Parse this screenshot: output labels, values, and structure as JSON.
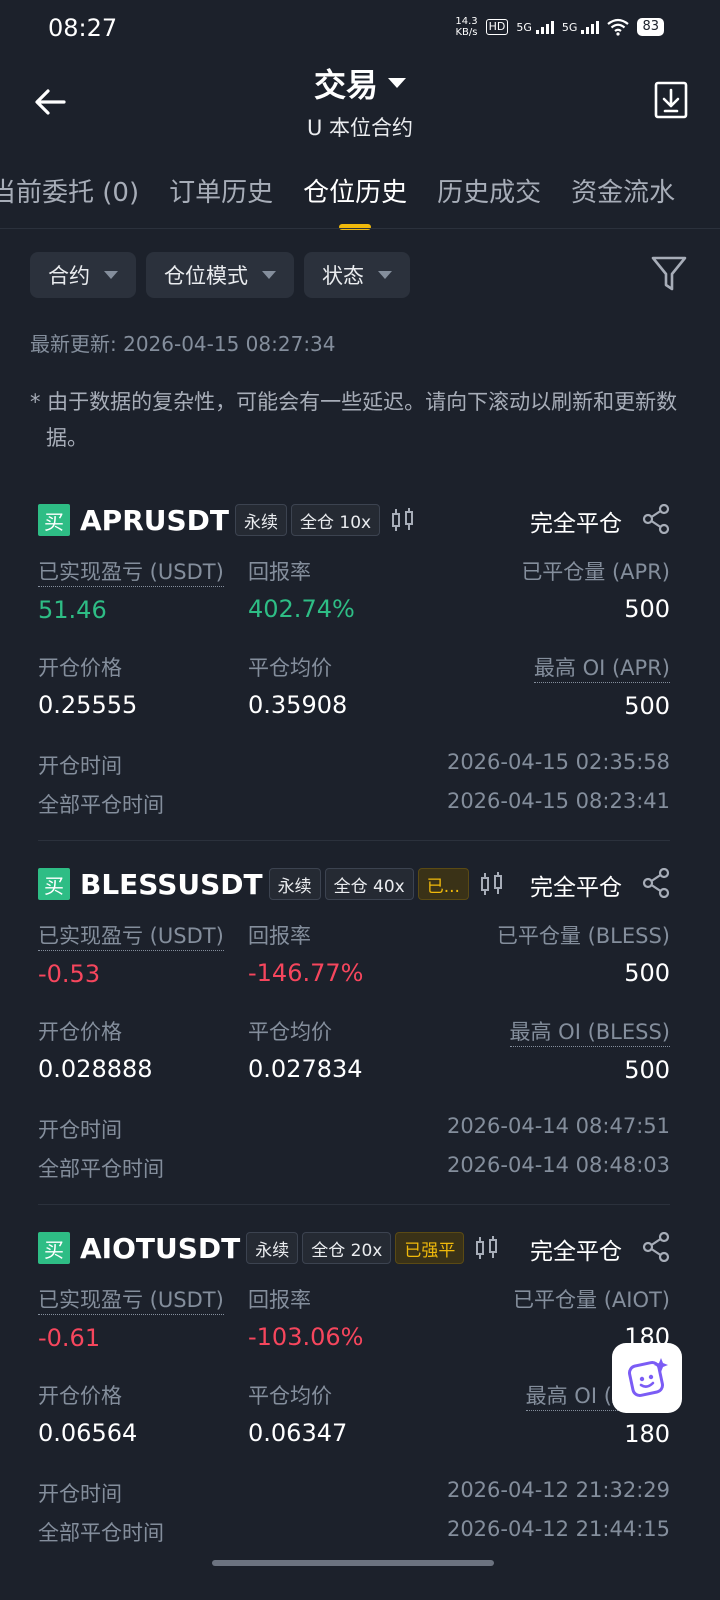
{
  "status_bar": {
    "time": "08:27",
    "net_speed_value": "14.3",
    "net_speed_unit": "KB/s",
    "hd": "HD",
    "signal1": "5G",
    "signal2": "5G",
    "battery": "83"
  },
  "header": {
    "title": "交易",
    "subtitle": "U 本位合约"
  },
  "tabs": [
    {
      "label": "当前委托 (0)"
    },
    {
      "label": "订单历史"
    },
    {
      "label": "仓位历史",
      "active": true
    },
    {
      "label": "历史成交"
    },
    {
      "label": "资金流水"
    }
  ],
  "filters": {
    "contract": "合约",
    "position_mode": "仓位模式",
    "status": "状态"
  },
  "last_updated": "最新更新: 2026-04-15 08:27:34",
  "notice": "* 由于数据的复杂性，可能会有一些延迟。请向下滚动以刷新和更新数据。",
  "labels": {
    "realized_pnl": "已实现盈亏 (USDT)",
    "roi": "回报率",
    "entry_price": "开仓价格",
    "avg_close_price": "平仓均价",
    "open_time": "开仓时间",
    "full_close_time": "全部平仓时间"
  },
  "positions": [
    {
      "side": "买",
      "symbol": "APRUSDT",
      "type_tag": "永续",
      "margin_tag": "全仓 10x",
      "status": "完全平仓",
      "realized_pnl": "51.46",
      "roi": "402.74%",
      "closed_qty_label": "已平仓量 (APR)",
      "closed_qty": "500",
      "entry_price": "0.25555",
      "avg_close_price": "0.35908",
      "max_oi_label": "最高 OI (APR)",
      "max_oi": "500",
      "open_time": "2026-04-15 02:35:58",
      "full_close_time": "2026-04-15 08:23:41"
    },
    {
      "side": "买",
      "symbol": "BLESSUSDT",
      "type_tag": "永续",
      "margin_tag": "全仓 40x",
      "extra_tag": "已...",
      "status": "完全平仓",
      "realized_pnl": "-0.53",
      "roi": "-146.77%",
      "closed_qty_label": "已平仓量 (BLESS)",
      "closed_qty": "500",
      "entry_price": "0.028888",
      "avg_close_price": "0.027834",
      "max_oi_label": "最高 OI (BLESS)",
      "max_oi": "500",
      "open_time": "2026-04-14 08:47:51",
      "full_close_time": "2026-04-14 08:48:03"
    },
    {
      "side": "买",
      "symbol": "AIOTUSDT",
      "type_tag": "永续",
      "margin_tag": "全仓 20x",
      "extra_tag": "已强平",
      "status": "完全平仓",
      "realized_pnl": "-0.61",
      "roi": "-103.06%",
      "closed_qty_label": "已平仓量 (AIOT)",
      "closed_qty": "180",
      "entry_price": "0.06564",
      "avg_close_price": "0.06347",
      "max_oi_label": "最高 OI (AIOT)",
      "max_oi": "180",
      "open_time": "2026-04-12 21:32:29",
      "full_close_time": "2026-04-12 21:44:15"
    }
  ],
  "colors": {
    "background": "#1c212b",
    "accent": "#f0b90b",
    "positive": "#2ebd85",
    "negative": "#f6465d"
  }
}
